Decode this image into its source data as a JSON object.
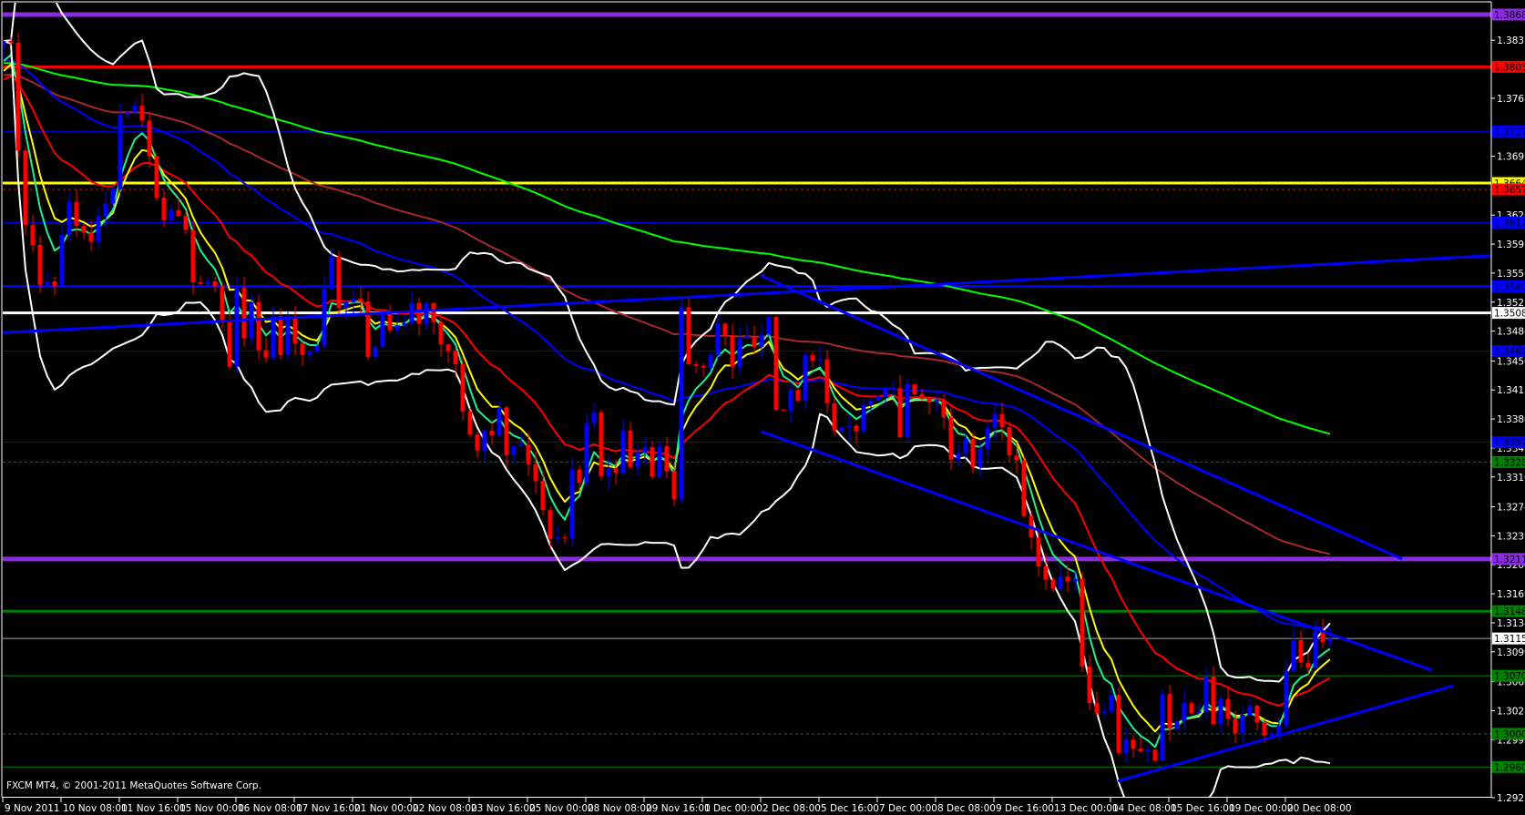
{
  "window": {
    "copyright": "FXCM MT4, © 2001-2011 MetaQuotes Software Corp."
  },
  "chart_data": {
    "type": "candlestick",
    "ylim": [
      1.2923,
      1.3873
    ],
    "first_open": 1.383,
    "closes": [
      1.3836,
      1.3834,
      1.3704,
      1.3614,
      1.359,
      1.3542,
      1.3546,
      1.354,
      1.3602,
      1.3642,
      1.3613,
      1.3605,
      1.3594,
      1.3625,
      1.364,
      1.3657,
      1.3747,
      1.375,
      1.3758,
      1.374,
      1.3697,
      1.3647,
      1.362,
      1.3632,
      1.3625,
      1.3608,
      1.3545,
      1.3543,
      1.3546,
      1.354,
      1.3499,
      1.3443,
      1.3538,
      1.3477,
      1.3521,
      1.3463,
      1.3454,
      1.3504,
      1.3457,
      1.3504,
      1.3471,
      1.3457,
      1.3461,
      1.3468,
      1.3537,
      1.3576,
      1.3514,
      1.3521,
      1.3525,
      1.3522,
      1.3455,
      1.3467,
      1.3509,
      1.3487,
      1.3493,
      1.3496,
      1.352,
      1.3495,
      1.352,
      1.3497,
      1.347,
      1.3462,
      1.3446,
      1.3389,
      1.3361,
      1.3342,
      1.3366,
      1.336,
      1.3394,
      1.3336,
      1.3347,
      1.3349,
      1.3325,
      1.3305,
      1.327,
      1.3235,
      1.3237,
      1.3236,
      1.3319,
      1.3303,
      1.3375,
      1.3388,
      1.3311,
      1.332,
      1.3315,
      1.3366,
      1.3322,
      1.334,
      1.3346,
      1.331,
      1.3347,
      1.3317,
      1.3283,
      1.3515,
      1.3446,
      1.3444,
      1.3442,
      1.3457,
      1.3495,
      1.3481,
      1.3443,
      1.3477,
      1.348,
      1.3467,
      1.3482,
      1.3503,
      1.3391,
      1.339,
      1.3415,
      1.3402,
      1.3457,
      1.345,
      1.3452,
      1.3399,
      1.3366,
      1.337,
      1.3372,
      1.3365,
      1.3397,
      1.3402,
      1.3407,
      1.3416,
      1.3417,
      1.3358,
      1.3422,
      1.341,
      1.3404,
      1.34,
      1.3403,
      1.3382,
      1.3331,
      1.3339,
      1.3356,
      1.3322,
      1.3344,
      1.3369,
      1.3386,
      1.337,
      1.3336,
      1.333,
      1.3263,
      1.3237,
      1.3202,
      1.3186,
      1.3175,
      1.319,
      1.3184,
      1.3187,
      1.3081,
      1.3037,
      1.3025,
      1.3027,
      1.3047,
      1.2977,
      1.2993,
      1.2982,
      1.2979,
      1.2981,
      1.2968,
      1.3048,
      1.3006,
      1.3015,
      1.3037,
      1.3025,
      1.3027,
      1.3069,
      1.3012,
      1.3042,
      1.3018,
      1.3001,
      1.3023,
      1.3034,
      1.3014,
      1.2998,
      1.3001,
      1.301,
      1.3076,
      1.3113,
      1.3086,
      1.308,
      1.3124,
      1.3111,
      1.3115
    ],
    "current_price": "1.31151",
    "y_ticks": [
      "1.38370",
      "1.37670",
      "1.36970",
      "1.36260",
      "1.35910",
      "1.35560",
      "1.35210",
      "1.34860",
      "1.34500",
      "1.34150",
      "1.33800",
      "1.33450",
      "1.33100",
      "1.32740",
      "1.32390",
      "1.32040",
      "1.31690",
      "1.31340",
      "1.30990",
      "1.30630",
      "1.30280",
      "1.29930",
      "1.29230"
    ],
    "x_tick_every_bars": 8,
    "x_ticks": [
      "9 Nov 2011",
      "10 Nov 08:00",
      "11 Nov 16:00",
      "15 Nov 00:00",
      "16 Nov 08:00",
      "17 Nov 16:00",
      "21 Nov 00:00",
      "22 Nov 08:00",
      "23 Nov 16:00",
      "25 Nov 00:00",
      "28 Nov 08:00",
      "29 Nov 16:00",
      "1 Dec 00:00",
      "2 Dec 08:00",
      "5 Dec 16:00",
      "7 Dec 00:00",
      "8 Dec 08:00",
      "9 Dec 16:00",
      "13 Dec 00:00",
      "14 Dec 08:00",
      "15 Dec 16:00",
      "19 Dec 00:00",
      "20 Dec 08:00"
    ],
    "horizontal_lines": [
      {
        "price": "1.38680",
        "color": "#8a2be2",
        "style": "thick"
      },
      {
        "price": "1.38050",
        "color": "#ff0000",
        "style": "medium"
      },
      {
        "price": "1.37270",
        "color": "#0000ff",
        "style": "thin"
      },
      {
        "price": "1.36647",
        "color": "#ffff00",
        "style": "medium"
      },
      {
        "price": "1.36570",
        "color": "#ff0000",
        "style": "dotted"
      },
      {
        "price": "1.36170",
        "color": "#0000ff",
        "style": "thin"
      },
      {
        "price": "1.35400",
        "color": "#0000ff",
        "style": "medium"
      },
      {
        "price": "1.35080",
        "color": "#ffffff",
        "style": "medium"
      },
      {
        "price": "1.34620",
        "color": "#0000ff",
        "style": "thin"
      },
      {
        "price": "1.33520",
        "color": "#0000ff",
        "style": "thin"
      },
      {
        "price": "1.33280",
        "color": "#008000",
        "style": "dotted"
      },
      {
        "price": "1.32110",
        "color": "#8a2be2",
        "style": "thick"
      },
      {
        "price": "1.31480",
        "color": "#008000",
        "style": "medium"
      },
      {
        "price": "1.30700",
        "color": "#008000",
        "style": "thin"
      },
      {
        "price": "1.30000",
        "color": "#008000",
        "style": "dotted"
      },
      {
        "price": "1.29600",
        "color": "#008000",
        "style": "thin"
      }
    ],
    "trendlines": [
      {
        "from": [
          -0.5,
          1.3484
        ],
        "to": [
          204.1,
          1.3577
        ],
        "color": "#0000ff"
      },
      {
        "from": [
          103.9,
          1.3553
        ],
        "to": [
          191.9,
          1.3211
        ],
        "color": "#0000ff"
      },
      {
        "from": [
          103.9,
          1.3365
        ],
        "to": [
          195.9,
          1.3077
        ],
        "color": "#0000ff"
      },
      {
        "from": [
          152.9,
          1.2943
        ],
        "to": [
          198.9,
          1.3058
        ],
        "color": "#0000ff"
      }
    ],
    "indicators": [
      {
        "name": "EMA",
        "period": 200,
        "color": "#00ff00",
        "seed": 1.3809
      },
      {
        "name": "EMA",
        "period": 100,
        "color": "#a52a2a",
        "seed": 1.3794
      },
      {
        "name": "EMA",
        "period": 55,
        "color": "#0000ff",
        "seed": 1.3811
      },
      {
        "name": "EMA",
        "period": 21,
        "color": "#ff0000",
        "seed": 1.3785
      },
      {
        "name": "EMA",
        "period": 8,
        "color": "#ffff00",
        "seed": 1.379
      },
      {
        "name": "EMA",
        "period": 5,
        "color": "#20f090",
        "seed": 1.38
      }
    ],
    "bollinger": {
      "period": 20,
      "deviation": 2,
      "color": "#ffffff"
    },
    "colors": {
      "bull": "#0000ff",
      "bear": "#ff0000",
      "background": "#000000",
      "axis": "#ffffff",
      "bid_line": "#a0a0a0"
    }
  }
}
